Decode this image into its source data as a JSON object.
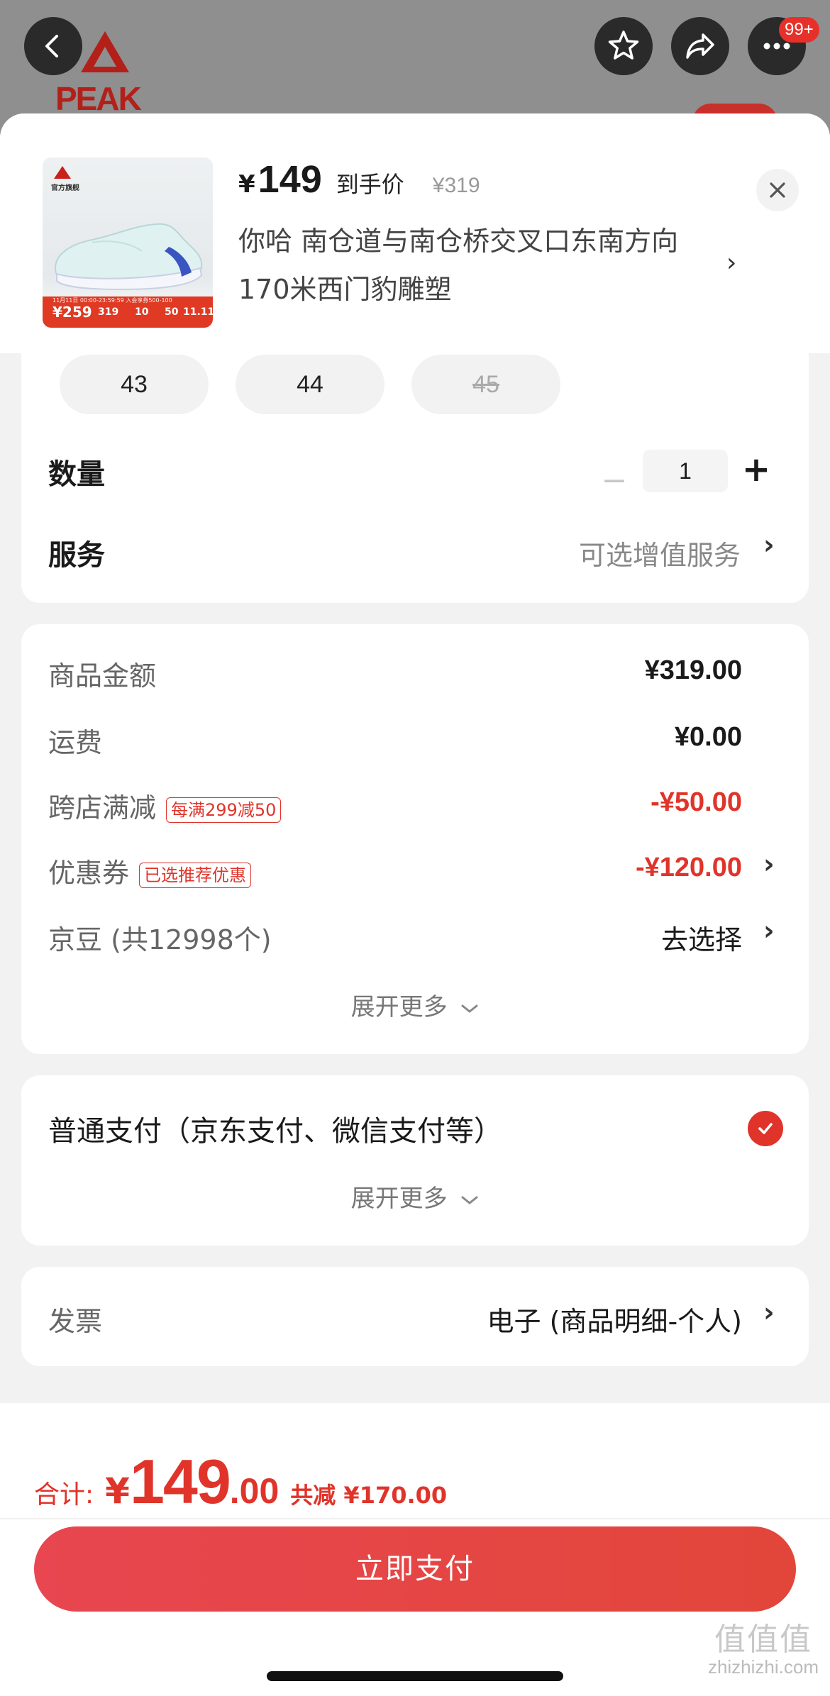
{
  "nav": {
    "badge": "99+",
    "brand_logo_text": "PEAK"
  },
  "product": {
    "thumb_brand": "官方旗舰",
    "thumb_strip_small": "11月11日 00:00-23:59:59 入会享券500-100",
    "thumb_price": "¥259",
    "thumb_v1": "319",
    "thumb_v2": "10",
    "thumb_v3": "50",
    "thumb_v4": "11.11",
    "yen": "¥",
    "price": "149",
    "price_label": "到手价",
    "orig_price": "¥319",
    "address": "你哈  南仓道与南仓桥交叉口东南方向170米西门豹雕塑"
  },
  "sizes": [
    {
      "label": "43",
      "disabled": false
    },
    {
      "label": "44",
      "disabled": false
    },
    {
      "label": "45",
      "disabled": true
    }
  ],
  "quantity": {
    "label": "数量",
    "value": "1",
    "minus": "−",
    "plus": "+"
  },
  "service": {
    "label": "服务",
    "value": "可选增值服务"
  },
  "summary": {
    "goods_label": "商品金额",
    "goods_value": "¥319.00",
    "shipping_label": "运费",
    "shipping_value": "¥0.00",
    "cross_label": "跨店满减",
    "cross_tag": "每满299减50",
    "cross_value": "-¥50.00",
    "coupon_label": "优惠券",
    "coupon_tag": "已选推荐优惠",
    "coupon_value": "-¥120.00",
    "jd_label": "京豆 (共12998个)",
    "jd_value": "去选择",
    "expand": "展开更多"
  },
  "payment": {
    "method": "普通支付（京东支付、微信支付等）",
    "expand": "展开更多"
  },
  "invoice": {
    "label": "发票",
    "value": "电子 (商品明细-个人)"
  },
  "footer": {
    "total_label": "合计:",
    "total_yen": "¥",
    "total_int": "149",
    "total_dec": ".00",
    "total_saved": "共减 ¥170.00",
    "pay_button": "立即支付"
  },
  "watermark": {
    "glyphs": "值值值",
    "site": "zhizhizhi.com"
  },
  "colors": {
    "accent": "#e0342a",
    "button": "#e84650"
  },
  "icons": [
    "back-icon",
    "star-icon",
    "share-icon",
    "more-icon",
    "close-icon",
    "chevron-right-icon",
    "check-icon"
  ]
}
